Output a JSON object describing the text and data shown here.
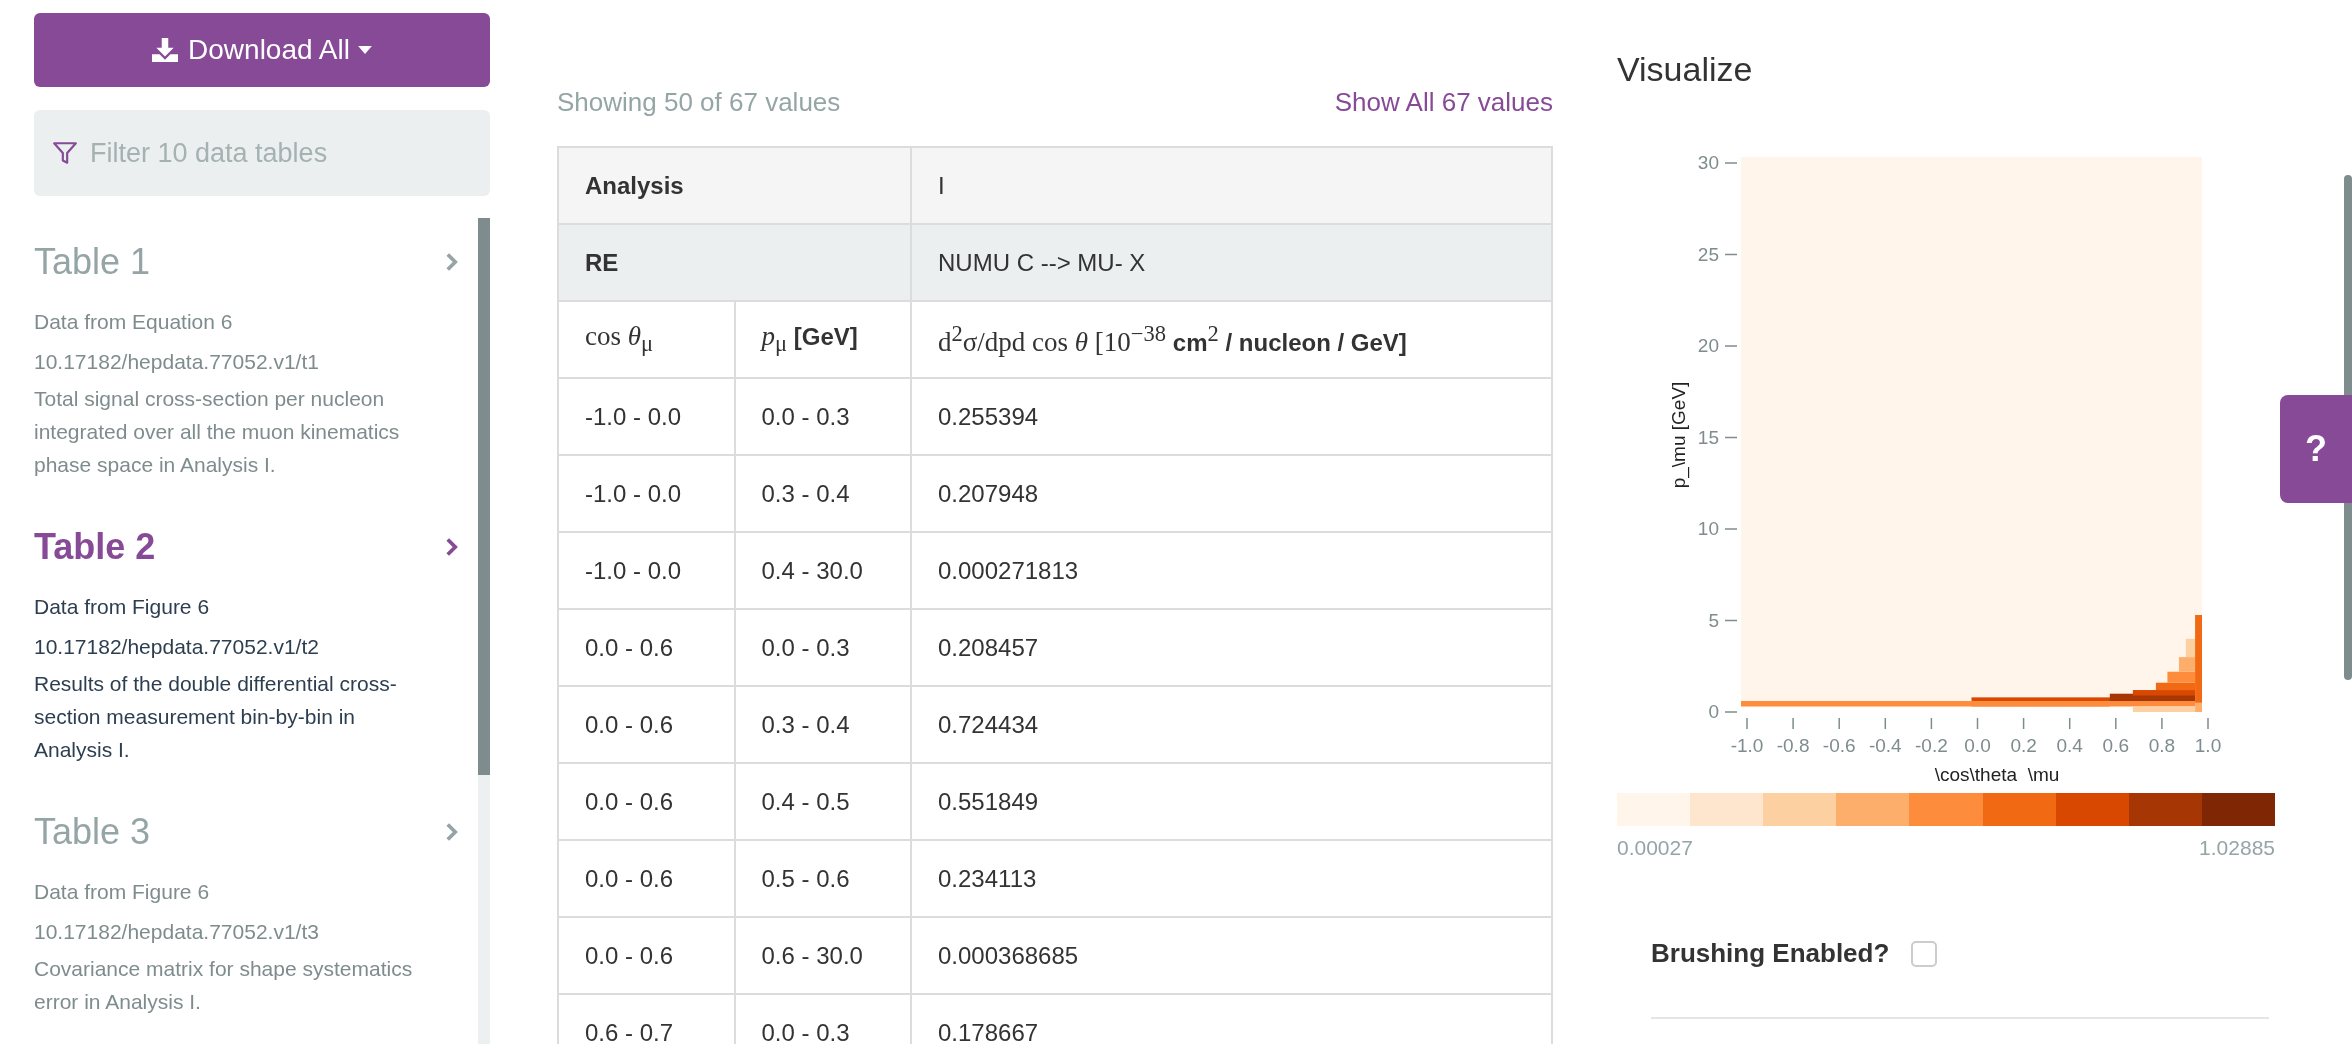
{
  "download_button": {
    "label": "Download All"
  },
  "filter": {
    "placeholder": "Filter 10 data tables"
  },
  "sidebar": {
    "items": [
      {
        "title": "Table 1",
        "source": "Data from Equation 6",
        "doi": "10.17182/hepdata.77052.v1/t1",
        "description": "Total signal cross-section per nucleon integrated over all the muon kinematics phase space in Analysis I.",
        "selected": false
      },
      {
        "title": "Table 2",
        "source": "Data from Figure 6",
        "doi": "10.17182/hepdata.77052.v1/t2",
        "description": "Results of the double differential cross-section measurement bin-by-bin in Analysis I.",
        "selected": true
      },
      {
        "title": "Table 3",
        "source": "Data from Figure 6",
        "doi": "10.17182/hepdata.77052.v1/t3",
        "description": "Covariance matrix for shape systematics error in Analysis I.",
        "selected": false
      }
    ]
  },
  "table_info": {
    "showing": "Showing 50 of 67 values",
    "show_all_link": "Show All 67 values"
  },
  "table": {
    "qualifiers": [
      {
        "name": "Analysis",
        "value": "I",
        "kind": "plain"
      },
      {
        "name": "RE",
        "value": "NUMU C --> MU- X",
        "kind": "shaded"
      }
    ],
    "columns": [
      "cos *θ*$_{μ}$",
      "*p*$_{μ}$ **[GeV]**",
      "d$^{2}$σ/dpd cos *θ* [10$^{−38}$ **cm**$^{2}$ **/ nucleon / GeV]**"
    ],
    "rows": [
      [
        "-1.0 - 0.0",
        "0.0 - 0.3",
        "0.255394"
      ],
      [
        "-1.0 - 0.0",
        "0.3 - 0.4",
        "0.207948"
      ],
      [
        "-1.0 - 0.0",
        "0.4 - 30.0",
        "0.000271813"
      ],
      [
        "0.0 - 0.6",
        "0.0 - 0.3",
        "0.208457"
      ],
      [
        "0.0 - 0.6",
        "0.3 - 0.4",
        "0.724434"
      ],
      [
        "0.0 - 0.6",
        "0.4 - 0.5",
        "0.551849"
      ],
      [
        "0.0 - 0.6",
        "0.5 - 0.6",
        "0.234113"
      ],
      [
        "0.0 - 0.6",
        "0.6 - 30.0",
        "0.000368685"
      ],
      [
        "0.6 - 0.7",
        "0.0 - 0.3",
        "0.178667"
      ]
    ]
  },
  "visualize": {
    "title": "Visualize",
    "heatmap": {
      "ylabel": "p_\\mu [GeV]",
      "xlabel": "\\cos\\theta  \\mu",
      "yticks": [
        "30",
        "25",
        "20",
        "15",
        "10",
        "5",
        "0"
      ],
      "xticks": [
        "-1.0",
        "-0.8",
        "-0.6",
        "-0.4",
        "-0.2",
        "0.0",
        "0.2",
        "0.4",
        "0.6",
        "0.8",
        "1.0"
      ]
    },
    "colorbar": {
      "segments": [
        {
          "color": "#fff5eb"
        },
        {
          "color": "#fee6ce"
        },
        {
          "color": "#fdd0a2"
        },
        {
          "color": "#fdae6b"
        },
        {
          "color": "#fd8d3c"
        },
        {
          "color": "#f16913"
        },
        {
          "color": "#d94801"
        },
        {
          "color": "#a63603"
        },
        {
          "color": "#7f2704"
        }
      ],
      "min_label": "0.00027",
      "max_label": "1.02885"
    },
    "brushing": {
      "label": "Brushing Enabled?",
      "checked": false
    }
  },
  "help_tab": {
    "label": "?"
  }
}
